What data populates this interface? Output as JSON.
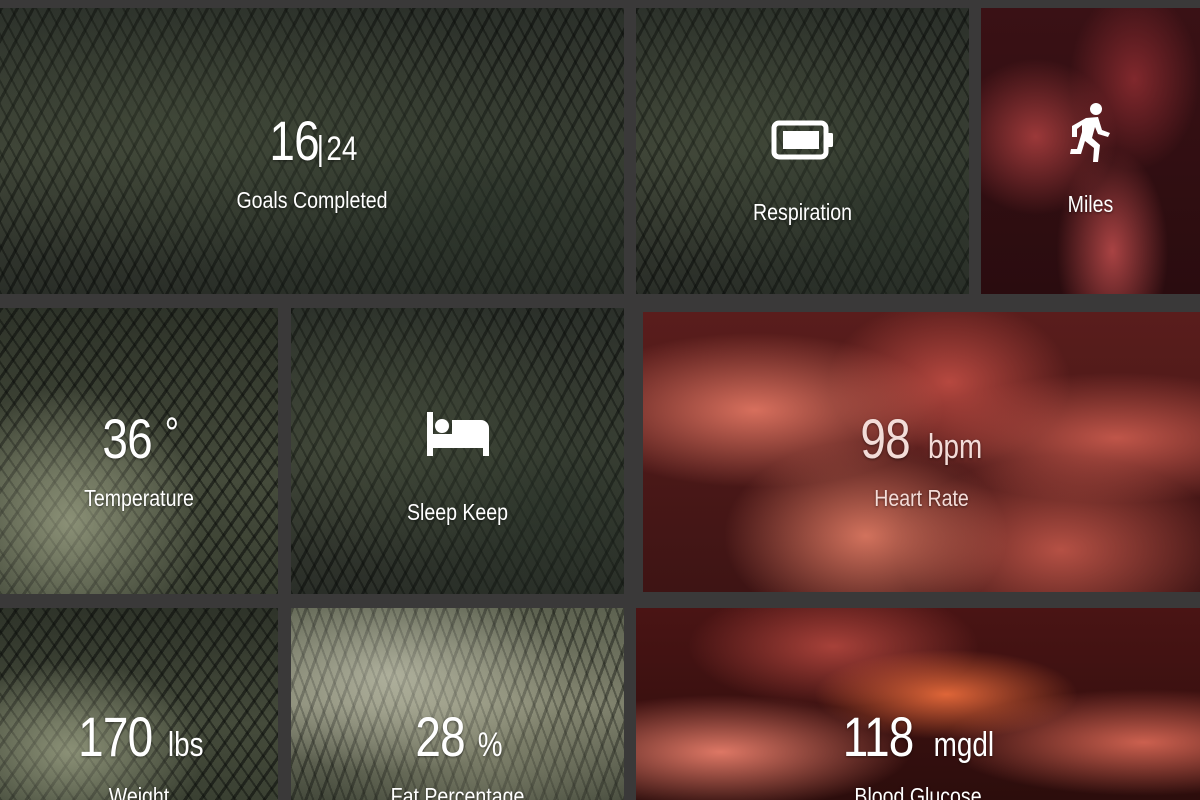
{
  "tiles": {
    "goals": {
      "value": "16",
      "separator": "|",
      "total": "24",
      "label": "Goals Completed"
    },
    "respiration": {
      "icon": "battery-icon",
      "label": "Respiration"
    },
    "miles": {
      "icon": "running-person-icon",
      "label": "Miles"
    },
    "temperature": {
      "value": "36",
      "unit": "°",
      "label": "Temperature"
    },
    "sleep": {
      "icon": "bed-icon",
      "label": "Sleep Keep"
    },
    "heart_rate": {
      "value": "98",
      "unit": "bpm",
      "label": "Heart Rate"
    },
    "weight": {
      "value": "170",
      "unit": "lbs",
      "label": "Weight"
    },
    "fat": {
      "value": "28",
      "unit": "%",
      "label": "Fat Percentage"
    },
    "glucose": {
      "value": "118",
      "unit": "mgdl",
      "label": "Blood Glucose"
    }
  },
  "colors": {
    "gap": "#3a3939",
    "text": "#ffffff",
    "heart_rate_text": "#f3dcd8"
  }
}
